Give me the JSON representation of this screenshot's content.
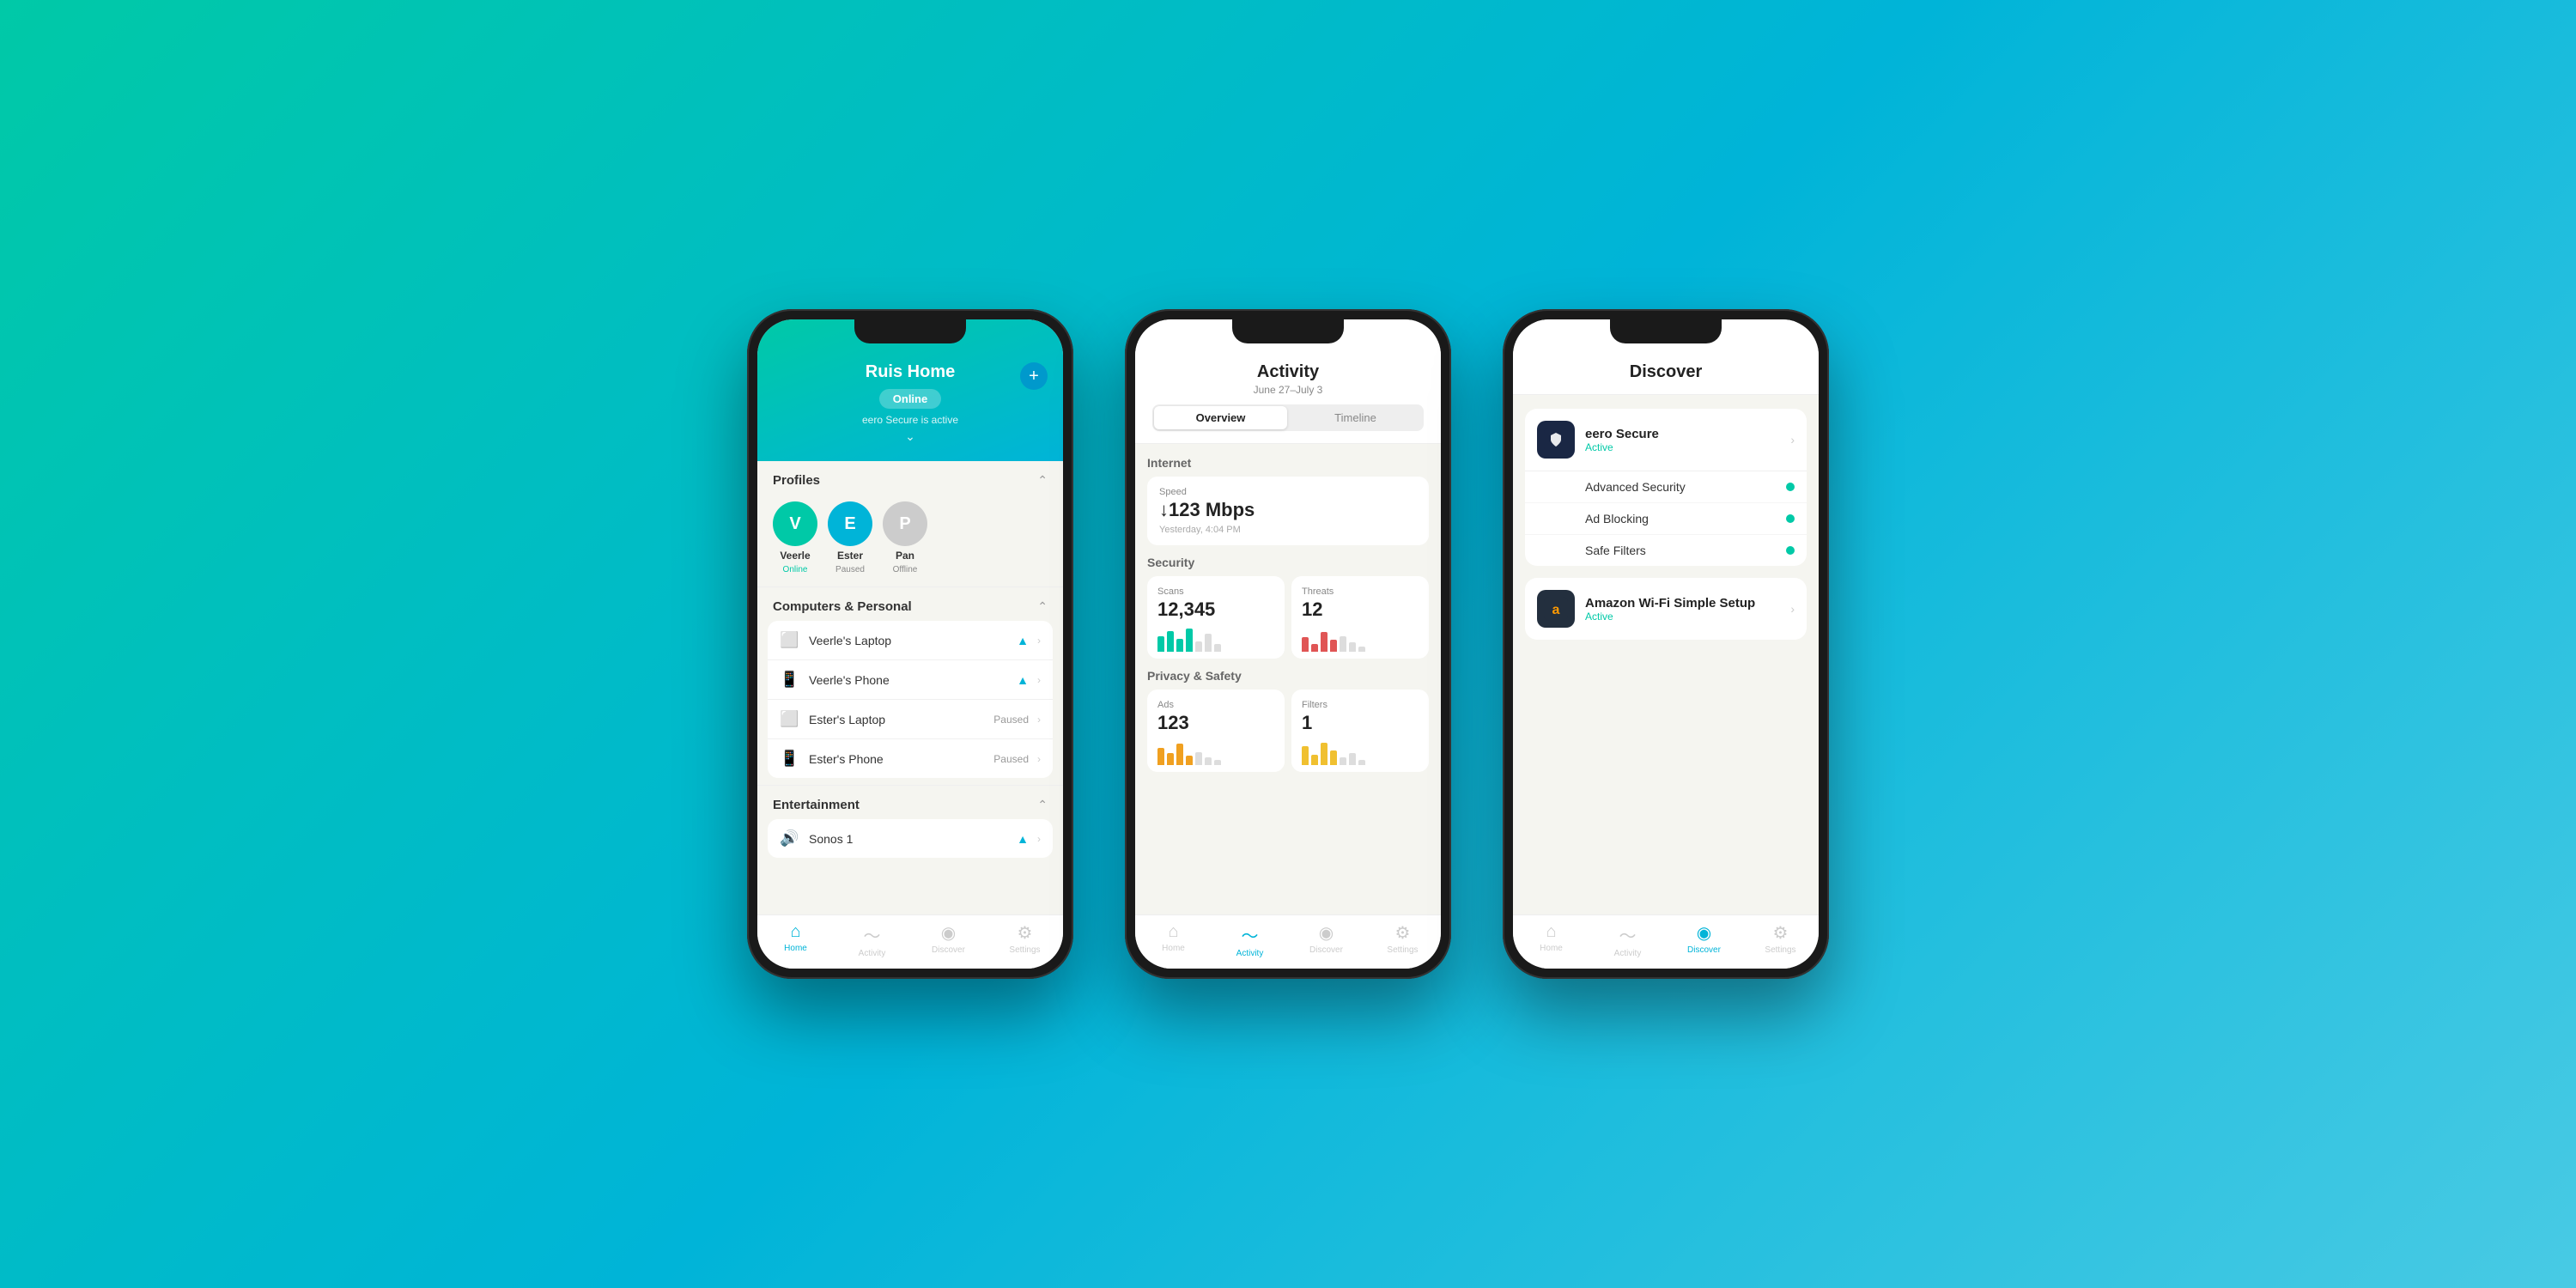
{
  "background": {
    "gradient": "teal to blue"
  },
  "phone1": {
    "header": {
      "title": "Ruis Home",
      "status": "Online",
      "secure_text": "eero Secure is active",
      "plus_button": "+"
    },
    "profiles_section": {
      "title": "Profiles",
      "profiles": [
        {
          "initial": "V",
          "name": "Veerle",
          "status": "Online",
          "color": "green"
        },
        {
          "initial": "E",
          "name": "Ester",
          "status": "Paused",
          "color": "teal"
        },
        {
          "initial": "P",
          "name": "Pan",
          "status": "Offline",
          "color": "gray"
        }
      ]
    },
    "computers_section": {
      "title": "Computers & Personal",
      "devices": [
        {
          "icon": "💻",
          "name": "Veerle's Laptop",
          "status": "wifi"
        },
        {
          "icon": "📱",
          "name": "Veerle's Phone",
          "status": "wifi"
        },
        {
          "icon": "💻",
          "name": "Ester's Laptop",
          "status": "Paused"
        },
        {
          "icon": "📱",
          "name": "Ester's Phone",
          "status": "Paused"
        }
      ]
    },
    "entertainment_section": {
      "title": "Entertainment",
      "devices": [
        {
          "icon": "🖥",
          "name": "Sonos 1",
          "status": "wifi"
        }
      ]
    },
    "nav": {
      "items": [
        {
          "label": "Home",
          "active": true
        },
        {
          "label": "Activity",
          "active": false
        },
        {
          "label": "Discover",
          "active": false
        },
        {
          "label": "Settings",
          "active": false
        }
      ]
    }
  },
  "phone2": {
    "header": {
      "title": "Activity",
      "subtitle": "June 27–July 3",
      "tabs": [
        {
          "label": "Overview",
          "active": true
        },
        {
          "label": "Timeline",
          "active": false
        }
      ]
    },
    "internet_section": {
      "title": "Internet",
      "speed": {
        "label": "Speed",
        "value": "↓123 Mbps",
        "time": "Yesterday, 4:04 PM"
      }
    },
    "security_section": {
      "title": "Security",
      "scans": {
        "label": "Scans",
        "value": "12,345",
        "bars": [
          {
            "h": 60,
            "color": "#00c9a7"
          },
          {
            "h": 80,
            "color": "#00c9a7"
          },
          {
            "h": 50,
            "color": "#00c9a7"
          },
          {
            "h": 90,
            "color": "#00c9a7"
          },
          {
            "h": 40,
            "color": "#ccc"
          },
          {
            "h": 70,
            "color": "#ccc"
          },
          {
            "h": 30,
            "color": "#ccc"
          }
        ]
      },
      "threats": {
        "label": "Threats",
        "value": "12",
        "bars": [
          {
            "h": 55,
            "color": "#e05555"
          },
          {
            "h": 30,
            "color": "#e05555"
          },
          {
            "h": 75,
            "color": "#e05555"
          },
          {
            "h": 45,
            "color": "#e05555"
          },
          {
            "h": 60,
            "color": "#ccc"
          },
          {
            "h": 35,
            "color": "#ccc"
          },
          {
            "h": 20,
            "color": "#ccc"
          }
        ]
      }
    },
    "privacy_section": {
      "title": "Privacy & Safety",
      "ads": {
        "label": "Ads",
        "value": "123",
        "bars": [
          {
            "h": 65,
            "color": "#f0a020"
          },
          {
            "h": 45,
            "color": "#f0a020"
          },
          {
            "h": 80,
            "color": "#f0a020"
          },
          {
            "h": 35,
            "color": "#f0a020"
          },
          {
            "h": 50,
            "color": "#ccc"
          },
          {
            "h": 30,
            "color": "#ccc"
          },
          {
            "h": 20,
            "color": "#ccc"
          }
        ]
      },
      "filters": {
        "label": "Filters",
        "value": "1",
        "bars": [
          {
            "h": 70,
            "color": "#f0c030"
          },
          {
            "h": 40,
            "color": "#f0c030"
          },
          {
            "h": 85,
            "color": "#f0c030"
          },
          {
            "h": 55,
            "color": "#f0c030"
          },
          {
            "h": 30,
            "color": "#ccc"
          },
          {
            "h": 45,
            "color": "#ccc"
          },
          {
            "h": 20,
            "color": "#ccc"
          }
        ]
      }
    },
    "nav": {
      "items": [
        {
          "label": "Home",
          "active": false
        },
        {
          "label": "Activity",
          "active": true
        },
        {
          "label": "Discover",
          "active": false
        },
        {
          "label": "Settings",
          "active": false
        }
      ]
    }
  },
  "phone3": {
    "header": {
      "title": "Discover"
    },
    "eero_secure": {
      "name": "eero Secure",
      "status": "Active",
      "features": [
        {
          "label": "Advanced Security"
        },
        {
          "label": "Ad Blocking"
        },
        {
          "label": "Safe Filters"
        }
      ]
    },
    "amazon_wifi": {
      "name": "Amazon Wi-Fi Simple Setup",
      "status": "Active"
    },
    "nav": {
      "items": [
        {
          "label": "Home",
          "active": false
        },
        {
          "label": "Activity",
          "active": false
        },
        {
          "label": "Discover",
          "active": true
        },
        {
          "label": "Settings",
          "active": false
        }
      ]
    }
  }
}
